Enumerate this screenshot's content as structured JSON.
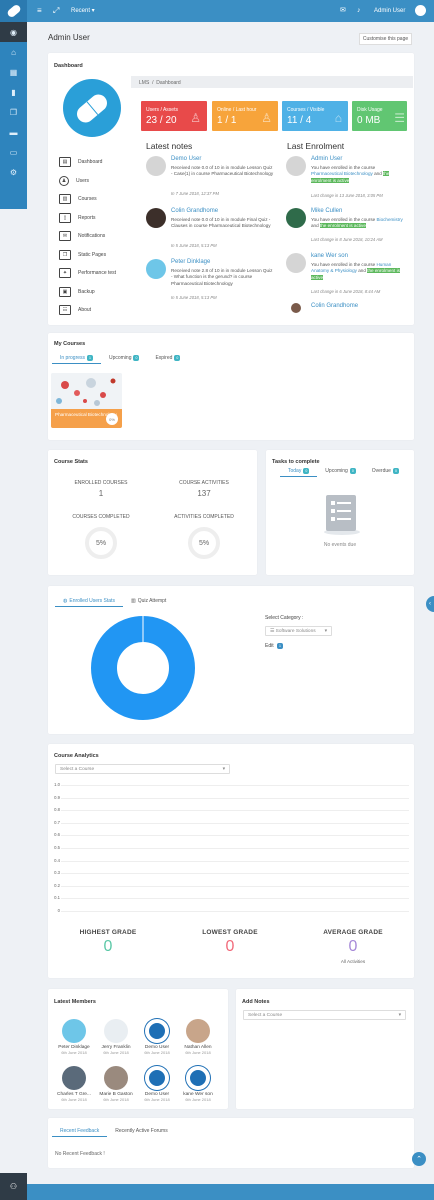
{
  "topbar": {
    "recent_label": "Recent",
    "user_name": "Admin User",
    "menu_icon": "hamburger-icon",
    "expand_icon": "fullscreen-icon",
    "mail_icon": "mail-icon",
    "bell_icon": "bell-icon"
  },
  "sidebar": {
    "icons": [
      "dashboard-icon",
      "home-icon",
      "calendar-icon",
      "book-icon",
      "copy-icon",
      "bookmark-icon",
      "folder-icon",
      "gear-icon"
    ],
    "bottom_icon": "sitemap-icon"
  },
  "page": {
    "title": "Admin User",
    "customise_label": "Customise this page"
  },
  "dashboard": {
    "title": "Dashboard",
    "breadcrumb": [
      "LMS",
      "/",
      "Dashboard"
    ],
    "menu": [
      {
        "label": "Dashboard",
        "icon": "dashboard-icon"
      },
      {
        "label": "Users",
        "icon": "users-icon"
      },
      {
        "label": "Courses",
        "icon": "courses-icon"
      },
      {
        "label": "Reports",
        "icon": "reports-icon"
      },
      {
        "label": "Notifications",
        "icon": "mail-icon"
      },
      {
        "label": "Static Pages",
        "icon": "pages-icon"
      },
      {
        "label": "Performance test",
        "icon": "performance-icon"
      },
      {
        "label": "Backup",
        "icon": "backup-icon"
      },
      {
        "label": "About",
        "icon": "about-icon"
      }
    ],
    "stats": [
      {
        "label": "Users / Assets",
        "value": "23 / 20",
        "color": "#e84a4a",
        "icon": "user-icon"
      },
      {
        "label": "Online / Last hour",
        "value": "1 / 1",
        "color": "#f7a43b",
        "icon": "user-icon"
      },
      {
        "label": "Courses / Visible",
        "value": "11 / 4",
        "color": "#4fb1e6",
        "icon": "graduation-icon"
      },
      {
        "label": "Disk Usage",
        "value": "0 MB",
        "color": "#61c672",
        "icon": "database-icon"
      }
    ],
    "latest_notes_title": "Latest notes",
    "notes": [
      {
        "name": "Demo User",
        "text": "Received note 0.0 of 10 in in module Lesson Quiz - Case(1) in course Pharmaceutical Biotechnology",
        "date": "In 7 June 2018, 12:37 PM"
      },
      {
        "name": "Colin Grandhome",
        "text": "Received note 0.0 of 10 in in module Final Quiz - Clauses in course Pharmaceutical Biotechnology",
        "date": "In 5 June 2018, 5:13 PM"
      },
      {
        "name": "Peter Dinklage",
        "text": "Received note 2.8 of 10 in in module Lesson Quiz - What function is the gerund? in course Pharmaceutical Biotechnology",
        "date": "In 5 June 2018, 5:13 PM"
      }
    ],
    "last_enrolment_title": "Last Enrolment",
    "enrolments": [
      {
        "name": "Admin User",
        "pre": "You have enrolled in the course",
        "course": "Pharmaceutical Biotechnology",
        "mid": "and",
        "status": "the enrolment is active",
        "date": "Last change in 13 June 2018, 3:05 PM"
      },
      {
        "name": "Mike Cullen",
        "pre": "You have enrolled in the course",
        "course": "Biochemistry",
        "mid": "and",
        "status": "the enrolment is active",
        "date": "Last change in 8 June 2018, 10:24 AM"
      },
      {
        "name": "kane Wer son",
        "pre": "You have enrolled in the course",
        "course": "Human Anatomy & Physiology",
        "mid": "and",
        "status": "the enrolment is active",
        "date": "Last change in 6 June 2018, 8:44 AM"
      },
      {
        "name": "Colin Grandhome"
      }
    ]
  },
  "my_courses": {
    "title": "My Courses",
    "tabs": [
      {
        "label": "In progress",
        "count": "1"
      },
      {
        "label": "Upcoming",
        "count": "0"
      },
      {
        "label": "Expired",
        "count": "0"
      }
    ],
    "course": {
      "name": "Pharmaceutical Biotechnology",
      "progress": "0%",
      "progress_value": 0
    }
  },
  "course_stats": {
    "title": "Course Stats",
    "enrolled_label": "ENROLLED COURSES",
    "enrolled_value": "1",
    "activities_label": "COURSE ACTIVITIES",
    "activities_value": "137",
    "completed_label": "COURSES COMPLETED",
    "completed_value": "5%",
    "act_completed_label": "ACTIVITIES COMPLETED",
    "act_completed_value": "5%"
  },
  "tasks": {
    "title": "Tasks to complete",
    "tabs": [
      {
        "label": "Today",
        "count": "0"
      },
      {
        "label": "Upcoming",
        "count": "0"
      },
      {
        "label": "Overdue",
        "count": "0"
      }
    ],
    "empty_text": "No events due"
  },
  "enrolled_stats": {
    "tabs": [
      "Enrolled Users Stats",
      "Quiz Attempt"
    ],
    "select_category_label": "Select Category :",
    "category_value": "Software Solutions",
    "edit_label": "Edit",
    "edit_count": "1"
  },
  "chart_data": {
    "type": "pie",
    "categories": [
      ""
    ],
    "values": [
      1
    ],
    "colors": [
      "#2196f3"
    ]
  },
  "analytics": {
    "title": "Course Analytics",
    "select_placeholder": "Select a Course",
    "y_ticks": [
      "1.0",
      "0.9",
      "0.8",
      "0.7",
      "0.6",
      "0.5",
      "0.4",
      "0.3",
      "0.2",
      "0.1",
      "0"
    ],
    "highest_label": "HIGHEST GRADE",
    "highest_value": "0",
    "lowest_label": "LOWEST GRADE",
    "lowest_value": "0",
    "average_label": "AVERAGE GRADE",
    "average_value": "0",
    "all_activities": "All Activities"
  },
  "members": {
    "title": "Latest Members",
    "list": [
      {
        "name": "Peter Dinklage",
        "date": "6th June 2018"
      },
      {
        "name": "Jerry Franklin",
        "date": "6th June 2018"
      },
      {
        "name": "Demo User",
        "date": "6th June 2018"
      },
      {
        "name": "Nathan Allen",
        "date": "6th June 2018"
      },
      {
        "name": "Charles T Gre...",
        "date": "6th June 2018"
      },
      {
        "name": "Marie B Gaston",
        "date": "6th June 2018"
      },
      {
        "name": "Demo User",
        "date": "6th June 2018"
      },
      {
        "name": "kane Wer son",
        "date": "6th June 2018"
      }
    ]
  },
  "add_notes": {
    "title": "Add Notes",
    "select_placeholder": "Select a Course"
  },
  "feedback": {
    "tabs": [
      "Recent Feedback",
      "Recently Active Forums"
    ],
    "empty_text": "No Recent Feedback !"
  }
}
